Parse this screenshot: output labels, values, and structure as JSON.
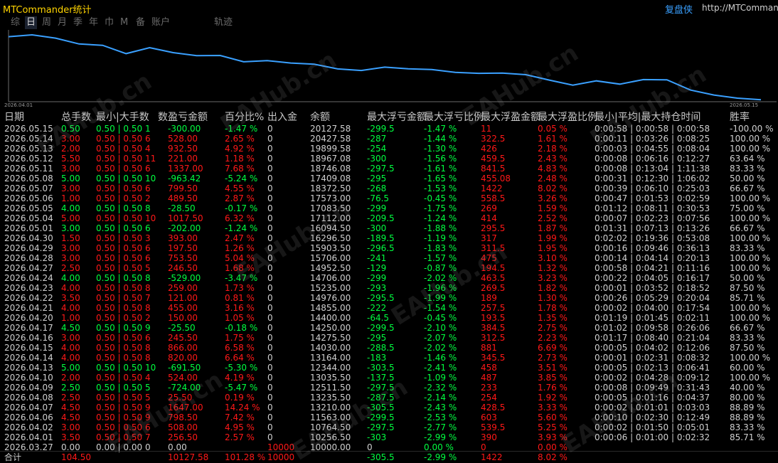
{
  "window": {
    "title": "MTCommander统计",
    "replay_label": "复盘侠",
    "url": "http://MTCommander"
  },
  "tabs": [
    "综",
    "日",
    "周",
    "月",
    "季",
    "年",
    "巾",
    "M",
    "备",
    "账户",
    "轨迹"
  ],
  "active_tab": "日",
  "watermark": "EAHub.cn",
  "chart_data": {
    "type": "line",
    "x_start_label": "2026.04.01",
    "x_end_label": "2026.05.15",
    "x": [
      "2026.03.27",
      "2026.04.01",
      "2026.04.02",
      "2026.04.06",
      "2026.04.07",
      "2026.04.08",
      "2026.04.09",
      "2026.04.10",
      "2026.04.13",
      "2026.04.14",
      "2026.04.15",
      "2026.04.16",
      "2026.04.17",
      "2026.04.20",
      "2026.04.21",
      "2026.04.22",
      "2026.04.23",
      "2026.04.24",
      "2026.04.27",
      "2026.04.28",
      "2026.04.29",
      "2026.04.30",
      "2026.05.01",
      "2026.05.04",
      "2026.05.05",
      "2026.05.06",
      "2026.05.07",
      "2026.05.08",
      "2026.05.11",
      "2026.05.12",
      "2026.05.13",
      "2026.05.14",
      "2026.05.15"
    ],
    "values": [
      10000.0,
      10256.5,
      10764.5,
      11563.0,
      13210.0,
      13235.5,
      12511.5,
      13035.5,
      12344.0,
      13164.0,
      14030.0,
      14275.5,
      14250.0,
      14400.0,
      14855.0,
      14976.0,
      15235.0,
      14706.0,
      14952.5,
      15706.0,
      15903.5,
      16296.5,
      16094.5,
      17112.0,
      17083.5,
      17573.0,
      18372.5,
      17409.08,
      18746.08,
      18967.08,
      19899.58,
      20427.58,
      20127.58
    ],
    "ylim": [
      9800,
      21000
    ],
    "color": "#3aa0ff"
  },
  "table": {
    "headers": [
      "日期",
      "总手数",
      "最小|大手数",
      "数",
      "盈亏金额",
      "百分比%",
      "出入金",
      "余额",
      "最大浮亏金额",
      "最大浮亏比例",
      "最大浮盈金额",
      "最大浮盈比例",
      "最小|平均|最大持仓时间",
      "胜率"
    ],
    "rows": [
      {
        "date": "2026.05.15",
        "lots": "0.50",
        "minmax": "0.50 | 0.50",
        "n": "1",
        "pl": "-300.00",
        "pct": "-1.47 %",
        "io": "0",
        "bal": "20127.58",
        "mfl": "-299.5",
        "mflp": "-1.47 %",
        "mfp": "11",
        "mfpp": "0.05 %",
        "time": "0:00:58 | 0:00:58 | 0:00:58",
        "win": "-100.00 %"
      },
      {
        "date": "2026.05.14",
        "lots": "3.00",
        "minmax": "0.50 | 0.50",
        "n": "6",
        "pl": "528.00",
        "pct": "2.65 %",
        "io": "0",
        "bal": "20427.58",
        "mfl": "-287",
        "mflp": "-1.44 %",
        "mfp": "322.5",
        "mfpp": "1.61 %",
        "time": "0:00:11 | 0:03:26 | 0:08:25",
        "win": "100.00 %"
      },
      {
        "date": "2026.05.13",
        "lots": "2.00",
        "minmax": "0.50 | 0.50",
        "n": "4",
        "pl": "932.50",
        "pct": "4.92 %",
        "io": "0",
        "bal": "19899.58",
        "mfl": "-254",
        "mflp": "-1.30 %",
        "mfp": "426",
        "mfpp": "2.18 %",
        "time": "0:00:03 | 0:04:55 | 0:08:04",
        "win": "100.00 %"
      },
      {
        "date": "2026.05.12",
        "lots": "5.50",
        "minmax": "0.50 | 0.50",
        "n": "11",
        "pl": "221.00",
        "pct": "1.18 %",
        "io": "0",
        "bal": "18967.08",
        "mfl": "-300",
        "mflp": "-1.56 %",
        "mfp": "459.5",
        "mfpp": "2.43 %",
        "time": "0:00:08 | 0:06:16 | 0:12:27",
        "win": "63.64 %"
      },
      {
        "date": "2026.05.11",
        "lots": "3.00",
        "minmax": "0.50 | 0.50",
        "n": "6",
        "pl": "1337.00",
        "pct": "7.68 %",
        "io": "0",
        "bal": "18746.08",
        "mfl": "-297.5",
        "mflp": "-1.61 %",
        "mfp": "841.5",
        "mfpp": "4.83 %",
        "time": "0:00:08 | 0:13:04 | 1:11:38",
        "win": "83.33 %"
      },
      {
        "date": "2026.05.08",
        "lots": "5.00",
        "minmax": "0.50 | 0.50",
        "n": "10",
        "pl": "-963.42",
        "pct": "-5.24 %",
        "io": "0",
        "bal": "17409.08",
        "mfl": "-295",
        "mflp": "-1.65 %",
        "mfp": "455.08",
        "mfpp": "2.48 %",
        "time": "0:00:31 | 0:12:30 | 1:06:02",
        "win": "50.00 %"
      },
      {
        "date": "2026.05.07",
        "lots": "3.00",
        "minmax": "0.50 | 0.50",
        "n": "6",
        "pl": "799.50",
        "pct": "4.55 %",
        "io": "0",
        "bal": "18372.50",
        "mfl": "-268",
        "mflp": "-1.53 %",
        "mfp": "1422",
        "mfpp": "8.02 %",
        "time": "0:00:39 | 0:06:10 | 0:25:03",
        "win": "66.67 %"
      },
      {
        "date": "2026.05.06",
        "lots": "1.00",
        "minmax": "0.50 | 0.50",
        "n": "2",
        "pl": "489.50",
        "pct": "2.87 %",
        "io": "0",
        "bal": "17573.00",
        "mfl": "-76.5",
        "mflp": "-0.45 %",
        "mfp": "558.5",
        "mfpp": "3.26 %",
        "time": "0:00:47 | 0:01:53 | 0:02:59",
        "win": "100.00 %"
      },
      {
        "date": "2026.05.05",
        "lots": "4.00",
        "minmax": "0.50 | 0.50",
        "n": "8",
        "pl": "-28.50",
        "pct": "-0.17 %",
        "io": "0",
        "bal": "17083.50",
        "mfl": "-299",
        "mflp": "-1.75 %",
        "mfp": "269",
        "mfpp": "1.59 %",
        "time": "0:01:12 | 0:08:11 | 0:30:53",
        "win": "75.00 %"
      },
      {
        "date": "2026.05.04",
        "lots": "5.00",
        "minmax": "0.50 | 0.50",
        "n": "10",
        "pl": "1017.50",
        "pct": "6.32 %",
        "io": "0",
        "bal": "17112.00",
        "mfl": "-209.5",
        "mflp": "-1.24 %",
        "mfp": "414",
        "mfpp": "2.52 %",
        "time": "0:00:07 | 0:02:23 | 0:07:56",
        "win": "100.00 %"
      },
      {
        "date": "2026.05.01",
        "lots": "3.00",
        "minmax": "0.50 | 0.50",
        "n": "6",
        "pl": "-202.00",
        "pct": "-1.24 %",
        "io": "0",
        "bal": "16094.50",
        "mfl": "-300",
        "mflp": "-1.88 %",
        "mfp": "295.5",
        "mfpp": "1.87 %",
        "time": "0:01:31 | 0:07:13 | 0:13:26",
        "win": "66.67 %"
      },
      {
        "date": "2026.04.30",
        "lots": "1.50",
        "minmax": "0.50 | 0.50",
        "n": "3",
        "pl": "393.00",
        "pct": "2.47 %",
        "io": "0",
        "bal": "16296.50",
        "mfl": "-189.5",
        "mflp": "-1.19 %",
        "mfp": "317",
        "mfpp": "1.99 %",
        "time": "0:02:02 | 0:19:36 | 0:53:08",
        "win": "100.00 %"
      },
      {
        "date": "2026.04.29",
        "lots": "3.00",
        "minmax": "0.50 | 0.50",
        "n": "6",
        "pl": "197.50",
        "pct": "1.26 %",
        "io": "0",
        "bal": "15903.50",
        "mfl": "-296.5",
        "mflp": "-1.83 %",
        "mfp": "311.5",
        "mfpp": "1.95 %",
        "time": "0:00:16 | 0:09:46 | 0:36:13",
        "win": "83.33 %"
      },
      {
        "date": "2026.04.28",
        "lots": "3.00",
        "minmax": "0.50 | 0.50",
        "n": "6",
        "pl": "753.50",
        "pct": "5.04 %",
        "io": "0",
        "bal": "15706.00",
        "mfl": "-241",
        "mflp": "-1.57 %",
        "mfp": "475",
        "mfpp": "3.10 %",
        "time": "0:00:14 | 0:04:14 | 0:20:13",
        "win": "100.00 %"
      },
      {
        "date": "2026.04.27",
        "lots": "2.50",
        "minmax": "0.50 | 0.50",
        "n": "5",
        "pl": "246.50",
        "pct": "1.68 %",
        "io": "0",
        "bal": "14952.50",
        "mfl": "-129",
        "mflp": "-0.87 %",
        "mfp": "194.5",
        "mfpp": "1.32 %",
        "time": "0:00:58 | 0:04:21 | 0:11:16",
        "win": "100.00 %"
      },
      {
        "date": "2026.04.24",
        "lots": "4.00",
        "minmax": "0.50 | 0.50",
        "n": "8",
        "pl": "-529.00",
        "pct": "-3.47 %",
        "io": "0",
        "bal": "14706.00",
        "mfl": "-299",
        "mflp": "-2.02 %",
        "mfp": "463.5",
        "mfpp": "3.23 %",
        "time": "0:00:22 | 0:04:05 | 0:16:17",
        "win": "50.00 %"
      },
      {
        "date": "2026.04.23",
        "lots": "4.00",
        "minmax": "0.50 | 0.50",
        "n": "8",
        "pl": "259.00",
        "pct": "1.73 %",
        "io": "0",
        "bal": "15235.00",
        "mfl": "-293",
        "mflp": "-1.96 %",
        "mfp": "269.5",
        "mfpp": "1.82 %",
        "time": "0:00:01 | 0:03:52 | 0:18:52",
        "win": "87.50 %"
      },
      {
        "date": "2026.04.22",
        "lots": "3.50",
        "minmax": "0.50 | 0.50",
        "n": "7",
        "pl": "121.00",
        "pct": "0.81 %",
        "io": "0",
        "bal": "14976.00",
        "mfl": "-295.5",
        "mflp": "-1.99 %",
        "mfp": "189",
        "mfpp": "1.30 %",
        "time": "0:00:26 | 0:05:29 | 0:20:04",
        "win": "85.71 %"
      },
      {
        "date": "2026.04.21",
        "lots": "4.00",
        "minmax": "0.50 | 0.50",
        "n": "8",
        "pl": "455.00",
        "pct": "3.16 %",
        "io": "0",
        "bal": "14855.00",
        "mfl": "-222",
        "mflp": "-1.54 %",
        "mfp": "257.5",
        "mfpp": "1.78 %",
        "time": "0:00:02 | 0:04:00 | 0:17:54",
        "win": "100.00 %"
      },
      {
        "date": "2026.04.20",
        "lots": "1.00",
        "minmax": "0.50 | 0.50",
        "n": "2",
        "pl": "150.00",
        "pct": "1.05 %",
        "io": "0",
        "bal": "14400.00",
        "mfl": "-64.5",
        "mflp": "-0.45 %",
        "mfp": "193.5",
        "mfpp": "1.35 %",
        "time": "0:01:19 | 0:01:45 | 0:02:11",
        "win": "100.00 %"
      },
      {
        "date": "2026.04.17",
        "lots": "4.50",
        "minmax": "0.50 | 0.50",
        "n": "9",
        "pl": "-25.50",
        "pct": "-0.18 %",
        "io": "0",
        "bal": "14250.00",
        "mfl": "-299.5",
        "mflp": "-2.10 %",
        "mfp": "384.5",
        "mfpp": "2.75 %",
        "time": "0:01:02 | 0:09:58 | 0:26:06",
        "win": "66.67 %"
      },
      {
        "date": "2026.04.16",
        "lots": "3.00",
        "minmax": "0.50 | 0.50",
        "n": "6",
        "pl": "245.50",
        "pct": "1.75 %",
        "io": "0",
        "bal": "14275.50",
        "mfl": "-295",
        "mflp": "-2.07 %",
        "mfp": "312.5",
        "mfpp": "2.23 %",
        "time": "0:01:17 | 0:08:40 | 0:21:04",
        "win": "83.33 %"
      },
      {
        "date": "2026.04.15",
        "lots": "4.00",
        "minmax": "0.50 | 0.50",
        "n": "8",
        "pl": "866.00",
        "pct": "6.58 %",
        "io": "0",
        "bal": "14030.00",
        "mfl": "-288.5",
        "mflp": "-2.02 %",
        "mfp": "881",
        "mfpp": "6.69 %",
        "time": "0:00:05 | 0:04:02 | 0:12:06",
        "win": "87.50 %"
      },
      {
        "date": "2026.04.14",
        "lots": "4.00",
        "minmax": "0.50 | 0.50",
        "n": "8",
        "pl": "820.00",
        "pct": "6.64 %",
        "io": "0",
        "bal": "13164.00",
        "mfl": "-183",
        "mflp": "-1.46 %",
        "mfp": "345.5",
        "mfpp": "2.73 %",
        "time": "0:00:01 | 0:02:31 | 0:08:32",
        "win": "100.00 %"
      },
      {
        "date": "2026.04.13",
        "lots": "5.00",
        "minmax": "0.50 | 0.50",
        "n": "10",
        "pl": "-691.50",
        "pct": "-5.30 %",
        "io": "0",
        "bal": "12344.00",
        "mfl": "-303.5",
        "mflp": "-2.41 %",
        "mfp": "458",
        "mfpp": "3.51 %",
        "time": "0:00:05 | 0:02:13 | 0:06:41",
        "win": "60.00 %"
      },
      {
        "date": "2026.04.10",
        "lots": "2.00",
        "minmax": "0.50 | 0.50",
        "n": "4",
        "pl": "524.00",
        "pct": "4.19 %",
        "io": "0",
        "bal": "13035.50",
        "mfl": "-137.5",
        "mflp": "-1.09 %",
        "mfp": "487",
        "mfpp": "3.85 %",
        "time": "0:00:02 | 0:04:28 | 0:09:12",
        "win": "100.00 %"
      },
      {
        "date": "2026.04.09",
        "lots": "2.50",
        "minmax": "0.50 | 0.50",
        "n": "5",
        "pl": "-724.00",
        "pct": "-5.47 %",
        "io": "0",
        "bal": "12511.50",
        "mfl": "-297.5",
        "mflp": "-2.32 %",
        "mfp": "233",
        "mfpp": "1.76 %",
        "time": "0:00:08 | 0:09:49 | 0:31:43",
        "win": "40.00 %"
      },
      {
        "date": "2026.04.08",
        "lots": "2.50",
        "minmax": "0.50 | 0.50",
        "n": "5",
        "pl": "25.50",
        "pct": "0.19 %",
        "io": "0",
        "bal": "13235.50",
        "mfl": "-287.5",
        "mflp": "-2.14 %",
        "mfp": "254",
        "mfpp": "1.92 %",
        "time": "0:00:05 | 0:01:16 | 0:04:37",
        "win": "80.00 %"
      },
      {
        "date": "2026.04.07",
        "lots": "4.50",
        "minmax": "0.50 | 0.50",
        "n": "9",
        "pl": "1647.00",
        "pct": "14.24 %",
        "io": "0",
        "bal": "13210.00",
        "mfl": "-305.5",
        "mflp": "-2.43 %",
        "mfp": "428.5",
        "mfpp": "3.33 %",
        "time": "0:00:02 | 0:01:01 | 0:03:03",
        "win": "88.89 %"
      },
      {
        "date": "2026.04.06",
        "lots": "4.50",
        "minmax": "0.50 | 0.50",
        "n": "9",
        "pl": "798.50",
        "pct": "7.42 %",
        "io": "0",
        "bal": "11563.00",
        "mfl": "-299.5",
        "mflp": "-2.53 %",
        "mfp": "603",
        "mfpp": "5.60 %",
        "time": "0:00:10 | 0:02:30 | 0:12:49",
        "win": "88.89 %"
      },
      {
        "date": "2026.04.02",
        "lots": "3.00",
        "minmax": "0.50 | 0.50",
        "n": "6",
        "pl": "508.00",
        "pct": "4.95 %",
        "io": "0",
        "bal": "10764.50",
        "mfl": "-297.5",
        "mflp": "-2.77 %",
        "mfp": "539.5",
        "mfpp": "5.25 %",
        "time": "0:00:02 | 0:01:50 | 0:05:01",
        "win": "83.33 %"
      },
      {
        "date": "2026.04.01",
        "lots": "3.50",
        "minmax": "0.50 | 0.50",
        "n": "7",
        "pl": "256.50",
        "pct": "2.57 %",
        "io": "0",
        "bal": "10256.50",
        "mfl": "-303",
        "mflp": "-2.99 %",
        "mfp": "390",
        "mfpp": "3.93 %",
        "time": "0:00:06 | 0:01:00 | 0:02:32",
        "win": "85.71 %"
      },
      {
        "date": "2026.03.27",
        "lots": "0.00",
        "minmax": "0.00 | 0.00",
        "n": "0",
        "pl": "0.00",
        "pct": "",
        "io": "10000",
        "bal": "10000.00",
        "mfl": "0",
        "mflp": "0.00 %",
        "mfp": "0",
        "mfpp": "0.00 %",
        "time": "",
        "win": ""
      }
    ],
    "total": {
      "label": "合计",
      "lots": "104.50",
      "pl": "10127.58",
      "pct": "101.28 %",
      "io": "10000",
      "mfl": "-305.5",
      "mflp": "-2.99 %",
      "mfp": "1422",
      "mfpp": "8.02 %"
    }
  },
  "colors": {
    "profit": "#ff1818",
    "loss": "#00ff40",
    "title": "#ffd400",
    "link": "#3aa0ff"
  }
}
